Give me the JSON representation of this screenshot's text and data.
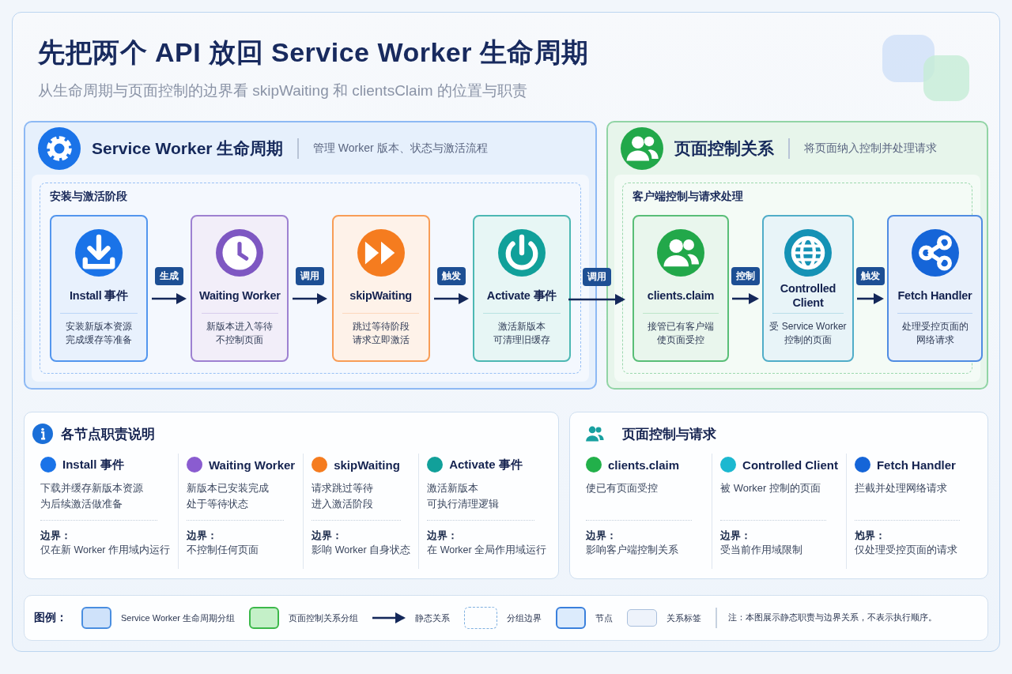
{
  "header": {
    "title": "先把两个 API 放回 Service Worker 生命周期",
    "subtitle": "从生命周期与页面控制的边界看 skipWaiting 和 clientsClaim 的位置与职责"
  },
  "groups": [
    {
      "title": "Service Worker 生命周期",
      "subtitle": "管理 Worker 版本、状态与激活流程",
      "color": "#1a73e8",
      "stage_label": "安装与激活阶段",
      "nodes": [
        {
          "title": "Install 事件",
          "description": [
            "安装新版本资源",
            "完成缓存等准备"
          ],
          "color": "#1a73e8",
          "arrow_label": "生成"
        },
        {
          "title": "Waiting Worker",
          "description": [
            "新版本进入等待",
            "不控制页面"
          ],
          "color": "#7e57c2",
          "arrow_label": "调用"
        },
        {
          "title": "skipWaiting",
          "description": [
            "跳过等待阶段",
            "请求立即激活"
          ],
          "color": "#f57c1f",
          "arrow_label": "触发"
        },
        {
          "title": "Activate 事件",
          "description": [
            "激活新版本",
            "可清理旧缓存"
          ],
          "color": "#11a09a",
          "arrow_label": "调用"
        }
      ]
    },
    {
      "title": "页面控制关系",
      "subtitle": "将页面纳入控制并处理请求",
      "color": "#22a84a",
      "stage_label": "客户端控制与请求处理",
      "nodes": [
        {
          "title": "clients.claim",
          "description": [
            "接管已有客户端",
            "使页面受控"
          ],
          "color": "#22a84a",
          "arrow_label": "控制"
        },
        {
          "title": "Controlled Client",
          "description": [
            "受 Service Worker",
            "控制的页面"
          ],
          "color": "#1592b5",
          "arrow_label": "触发"
        },
        {
          "title": "Fetch Handler",
          "description": [
            "处理受控页面的",
            "网络请求"
          ],
          "color": "#1565d8"
        }
      ]
    }
  ],
  "duty_cards": [
    {
      "title": "各节点职责说明",
      "items": [
        {
          "title": "Install 事件",
          "color": "#1a73e8",
          "description": [
            "下载并缓存新版本资源",
            "为后续激活做准备"
          ],
          "boundary_label": "边界：",
          "boundary": "仅在新 Worker 作用域内运行"
        },
        {
          "title": "Waiting Worker",
          "color": "#8a5cd0",
          "description": [
            "新版本已安装完成",
            "处于等待状态"
          ],
          "boundary_label": "边界：",
          "boundary": "不控制任何页面"
        },
        {
          "title": "skipWaiting",
          "color": "#f57c1f",
          "description": [
            "请求跳过等待",
            "进入激活阶段"
          ],
          "boundary_label": "边界：",
          "boundary": "影响 Worker 自身状态"
        },
        {
          "title": "Activate 事件",
          "color": "#11a09a",
          "description": [
            "激活新版本",
            "可执行清理逻辑"
          ],
          "boundary_label": "边界：",
          "boundary": "在 Worker 全局作用域运行"
        }
      ]
    },
    {
      "title": "页面控制与请求",
      "items": [
        {
          "title": "clients.claim",
          "color": "#22b04a",
          "description": [
            "使已有页面受控"
          ],
          "boundary_label": "边界：",
          "boundary": "影响客户端控制关系"
        },
        {
          "title": "Controlled Client",
          "color": "#1cb8d0",
          "description": [
            "被 Worker 控制的页面"
          ],
          "boundary_label": "边界：",
          "boundary": "受当前作用域限制"
        },
        {
          "title": "Fetch Handler",
          "color": "#1565d8",
          "description": [
            "拦截并处理网络请求"
          ],
          "boundary_label": "尥界：",
          "boundary": "仅处理受控页面的请求"
        }
      ]
    }
  ],
  "legend": {
    "title": "图例：",
    "items": [
      {
        "kind": "group",
        "label": "Service Worker 生命周期分组"
      },
      {
        "kind": "group2",
        "label": "页面控制关系分组"
      },
      {
        "kind": "arrow",
        "label": "静态关系"
      },
      {
        "kind": "dashed",
        "label": "分组边界"
      },
      {
        "kind": "node",
        "label": "节点"
      },
      {
        "kind": "tag",
        "label": "关系标签"
      }
    ],
    "note": "注：本图展示静态职责与边界关系，不表示执行顺序。"
  }
}
